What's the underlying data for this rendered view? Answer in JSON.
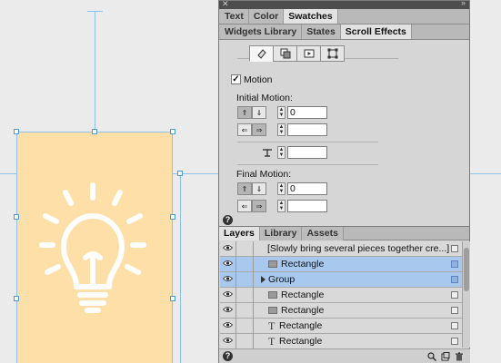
{
  "panel_top": {
    "tabs": [
      "Text",
      "Color",
      "Swatches"
    ],
    "active_tab": "Swatches",
    "subtabs": [
      "Widgets Library",
      "States",
      "Scroll Effects"
    ],
    "active_subtab": "Scroll Effects",
    "motion_checkbox": {
      "label": "Motion",
      "checked": true
    },
    "initial_motion": {
      "heading": "Initial Motion:",
      "vertical_value": "0",
      "horizontal_value": ""
    },
    "key_position_value": "",
    "final_motion": {
      "heading": "Final Motion:",
      "vertical_value": "0",
      "horizontal_value": ""
    }
  },
  "layers": {
    "tabs": [
      "Layers",
      "Library",
      "Assets"
    ],
    "active_tab": "Layers",
    "rows": [
      {
        "name": "[Slowly bring several pieces together cre...]",
        "type": "state",
        "selected": false
      },
      {
        "name": "Rectangle",
        "type": "rect",
        "selected": true
      },
      {
        "name": "Group",
        "type": "group",
        "selected": true
      },
      {
        "name": "Rectangle",
        "type": "rect",
        "selected": false
      },
      {
        "name": "Rectangle",
        "type": "rect",
        "selected": false
      },
      {
        "name": "Rectangle",
        "type": "text",
        "selected": false
      },
      {
        "name": "Rectangle",
        "type": "text",
        "selected": false
      }
    ]
  },
  "colors": {
    "artboard": "#fddfa7",
    "selection": "#a9c8ee",
    "guide": "#8ec0e8"
  }
}
